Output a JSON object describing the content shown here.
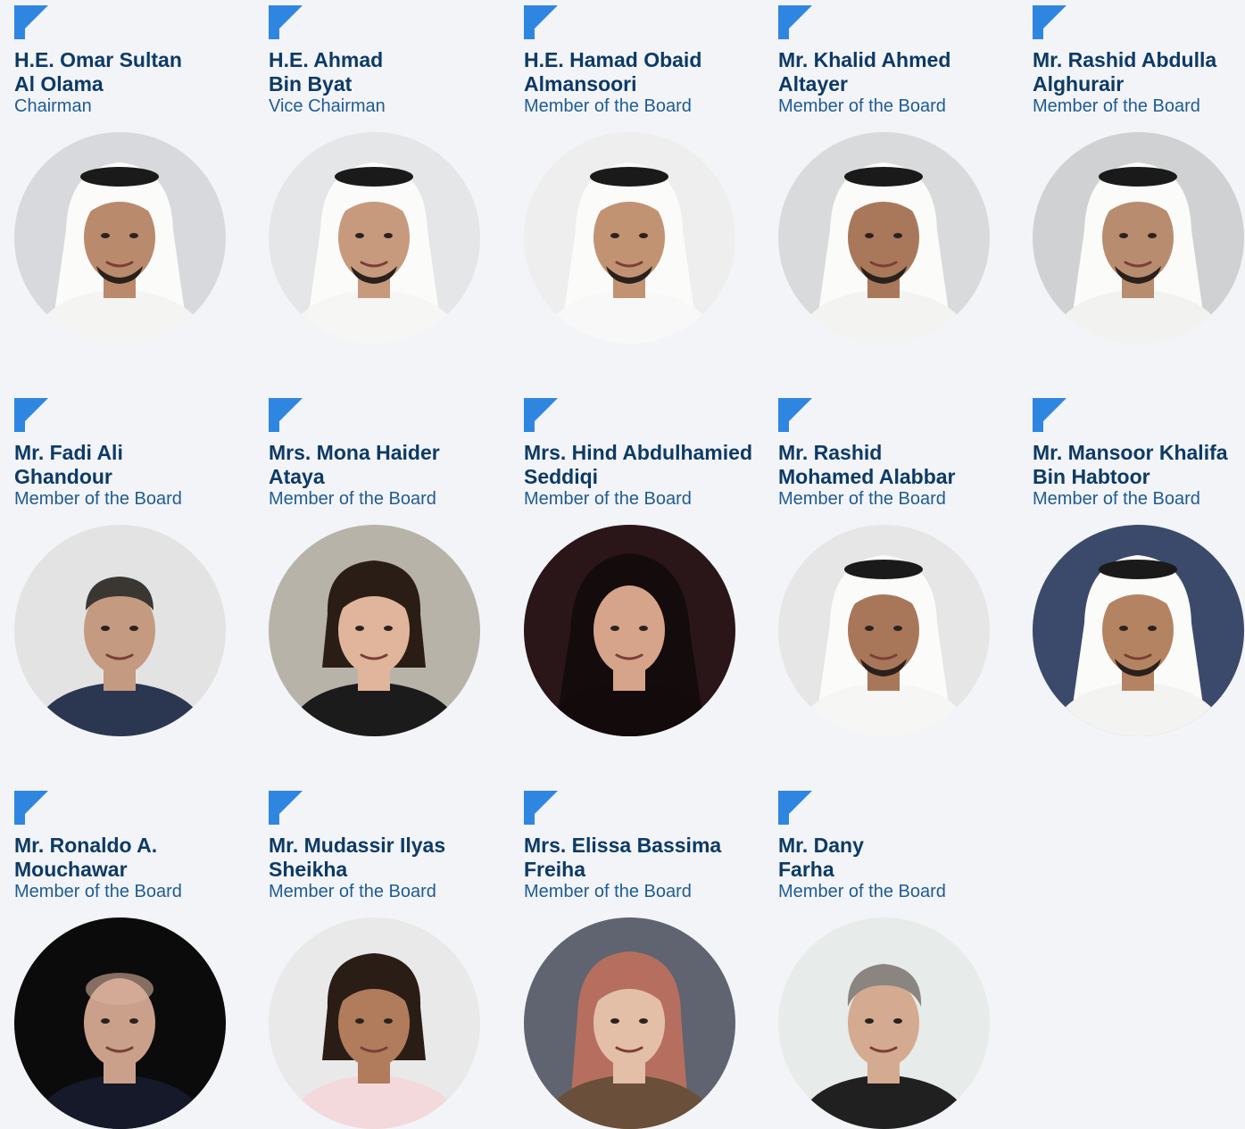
{
  "accent_color": "#2f86e0",
  "name_color": "#0d3a66",
  "role_color": "#1f5b93",
  "members": [
    {
      "name_line1": "H.E. Omar Sultan",
      "name_line2": "Al Olama",
      "role": "Chairman",
      "icon": "corner-bracket-icon",
      "photo": {
        "bg": "#d7d9dc",
        "skin": "#b98a6b",
        "attire": "#f4f4f2",
        "headwear": "ghutra-agal"
      }
    },
    {
      "name_line1": "H.E. Ahmad",
      "name_line2": "Bin Byat",
      "role": "Vice Chairman",
      "icon": "corner-bracket-icon",
      "photo": {
        "bg": "#e4e6e8",
        "skin": "#c79a7e",
        "attire": "#f6f6f4",
        "headwear": "ghutra-agal"
      }
    },
    {
      "name_line1": "H.E. Hamad Obaid",
      "name_line2": "Almansoori",
      "role": "Member of the Board",
      "icon": "corner-bracket-icon",
      "photo": {
        "bg": "#eeeeee",
        "skin": "#c29373",
        "attire": "#f8f8f8",
        "headwear": "ghutra-agal"
      }
    },
    {
      "name_line1": "Mr. Khalid Ahmed",
      "name_line2": "Altayer",
      "role": "Member of the Board",
      "icon": "corner-bracket-icon",
      "photo": {
        "bg": "#d9dadb",
        "skin": "#a9785a",
        "attire": "#f3f3f1",
        "headwear": "ghutra-agal"
      }
    },
    {
      "name_line1": "Mr. Rashid Abdulla",
      "name_line2": "Alghurair",
      "role": "Member of the Board",
      "icon": "corner-bracket-icon",
      "photo": {
        "bg": "#cfd1d2",
        "skin": "#b88c6e",
        "attire": "#f2f2f0",
        "headwear": "ghutra-agal"
      }
    },
    {
      "name_line1": "Mr. Fadi Ali",
      "name_line2": "Ghandour",
      "role": "Member of the Board",
      "icon": "corner-bracket-icon",
      "photo": {
        "bg": "#e3e3e3",
        "skin": "#c49a80",
        "attire": "#2b3650",
        "headwear": "none"
      }
    },
    {
      "name_line1": "Mrs. Mona Haider",
      "name_line2": "Ataya",
      "role": "Member of the Board",
      "icon": "corner-bracket-icon",
      "photo": {
        "bg": "#b8b3a9",
        "skin": "#e0b59c",
        "attire": "#1b1b1b",
        "headwear": "dark-hair"
      }
    },
    {
      "name_line1": "Mrs. Hind Abdulhamied",
      "name_line2": "Seddiqi",
      "role": "Member of the Board",
      "icon": "corner-bracket-icon",
      "photo": {
        "bg": "#2a1518",
        "skin": "#d6a48a",
        "attire": "#120a0b",
        "headwear": "shayla"
      }
    },
    {
      "name_line1": "Mr. Rashid",
      "name_line2": "Mohamed Alabbar",
      "role": "Member of the Board",
      "icon": "corner-bracket-icon",
      "photo": {
        "bg": "#e6e6e6",
        "skin": "#a8775a",
        "attire": "#f6f6f4",
        "headwear": "ghutra-agal"
      }
    },
    {
      "name_line1": "Mr. Mansoor Khalifa",
      "name_line2": "Bin Habtoor",
      "role": "Member of the Board",
      "icon": "corner-bracket-icon",
      "photo": {
        "bg": "#3b4a6b",
        "skin": "#b48462",
        "attire": "#f3f3f1",
        "headwear": "ghutra-agal"
      }
    },
    {
      "name_line1": "Mr. Ronaldo A.",
      "name_line2": "Mouchawar",
      "role": "Member of the Board",
      "icon": "corner-bracket-icon",
      "photo": {
        "bg": "#0b0b0c",
        "skin": "#caa08a",
        "attire": "#15192a",
        "headwear": "bald"
      }
    },
    {
      "name_line1": "Mr. Mudassir Ilyas",
      "name_line2": "Sheikha",
      "role": "Member of the Board",
      "icon": "corner-bracket-icon",
      "photo": {
        "bg": "#e9e9e9",
        "skin": "#b07c5c",
        "attire": "#f3d9dc",
        "headwear": "dark-hair"
      }
    },
    {
      "name_line1": "Mrs. Elissa Bassima",
      "name_line2": "Freiha",
      "role": "Member of the Board",
      "icon": "corner-bracket-icon",
      "photo": {
        "bg": "#5f6470",
        "skin": "#e3bfa8",
        "attire": "#6a4f3a",
        "headwear": "pink-hair"
      }
    },
    {
      "name_line1": "Mr. Dany",
      "name_line2": "Farha",
      "role": "Member of the Board",
      "icon": "corner-bracket-icon",
      "photo": {
        "bg": "#e7ebe9",
        "skin": "#d4aa90",
        "attire": "#202020",
        "headwear": "grey-hair"
      }
    }
  ]
}
